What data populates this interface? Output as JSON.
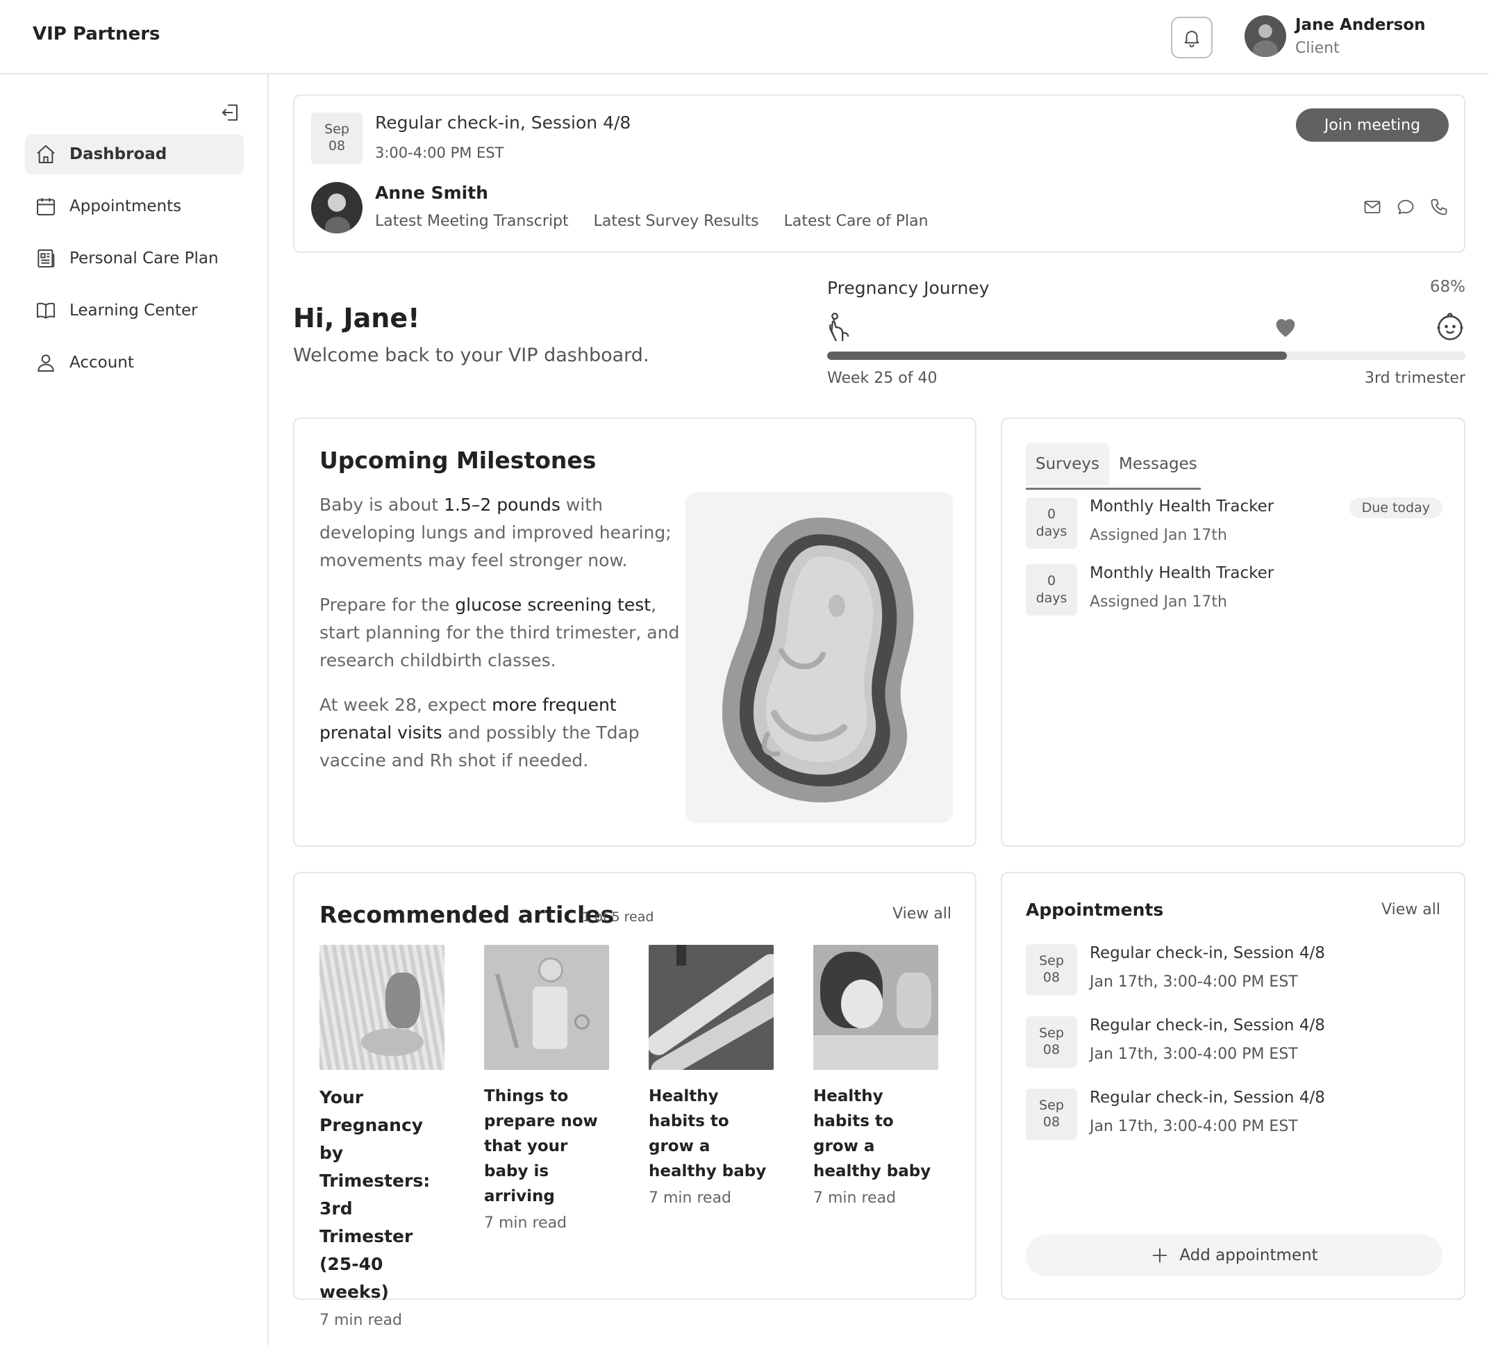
{
  "brand": "VIP Partners",
  "user": {
    "name": "Jane Anderson",
    "role": "Client"
  },
  "sidebar": {
    "items": [
      {
        "label": "Dashbroad",
        "icon": "home-icon",
        "active": true
      },
      {
        "label": "Appointments",
        "icon": "calendar-icon"
      },
      {
        "label": "Personal Care Plan",
        "icon": "document-icon"
      },
      {
        "label": "Learning Center",
        "icon": "book-icon"
      },
      {
        "label": "Account",
        "icon": "user-icon"
      }
    ]
  },
  "meeting": {
    "month": "Sep",
    "day": "08",
    "title": "Regular check-in, Session 4/8",
    "time": "3:00-4:00 PM EST",
    "join_label": "Join meeting",
    "provider": "Anne Smith",
    "links": [
      "Latest Meeting Transcript",
      "Latest Survey Results",
      "Latest Care of Plan"
    ]
  },
  "greeting": {
    "title": "Hi, Jane!",
    "subtitle": "Welcome back to your VIP dashboard."
  },
  "journey": {
    "title": "Pregnancy Journey",
    "percent_label": "68%",
    "progress_fraction": 0.72,
    "week_label": "Week 25 of 40",
    "trimester_label": "3rd trimester"
  },
  "milestones": {
    "title": "Upcoming Milestones",
    "p1_a": "Baby is about ",
    "p1_b": "1.5–2 pounds",
    "p1_c": " with developing lungs and improved hearing; movements may feel stronger now.",
    "p2_a": "Prepare for the ",
    "p2_b": "glucose screening test",
    "p2_c": ", start planning for the third trimester, and research childbirth classes.",
    "p3_a": "At week 28, expect ",
    "p3_b": "more frequent prenatal visits",
    "p3_c": " and possibly the Tdap vaccine and Rh shot if needed."
  },
  "surveys": {
    "tabs": [
      "Surveys",
      "Messages"
    ],
    "items": [
      {
        "days_num": "0",
        "days_unit": "days",
        "name": "Monthly Health Tracker",
        "assigned": "Assigned Jan 17th",
        "badge": "Due today"
      },
      {
        "days_num": "0",
        "days_unit": "days",
        "name": "Monthly Health Tracker",
        "assigned": "Assigned Jan 17th"
      }
    ]
  },
  "articles": {
    "title": "Recommended articles",
    "count": "1 of 5 read",
    "view_all": "View all",
    "items": [
      {
        "title": "Your Pregnancy by Trimesters: 3rd Trimester (25-40 weeks)",
        "read": "7 min read"
      },
      {
        "title": "Things to prepare now that your baby is arriving",
        "read": "7 min read"
      },
      {
        "title": "Healthy habits to grow a healthy baby",
        "read": "7 min read"
      },
      {
        "title": "Healthy habits to grow a healthy baby",
        "read": "7 min read"
      }
    ]
  },
  "appointments": {
    "title": "Appointments",
    "view_all": "View all",
    "items": [
      {
        "month": "Sep",
        "day": "08",
        "title": "Regular check-in, Session 4/8",
        "time": "Jan 17th, 3:00-4:00 PM EST"
      },
      {
        "month": "Sep",
        "day": "08",
        "title": "Regular check-in, Session 4/8",
        "time": "Jan 17th, 3:00-4:00 PM EST"
      },
      {
        "month": "Sep",
        "day": "08",
        "title": "Regular check-in, Session 4/8",
        "time": "Jan 17th, 3:00-4:00 PM EST"
      }
    ],
    "add_label": "Add appointment"
  }
}
